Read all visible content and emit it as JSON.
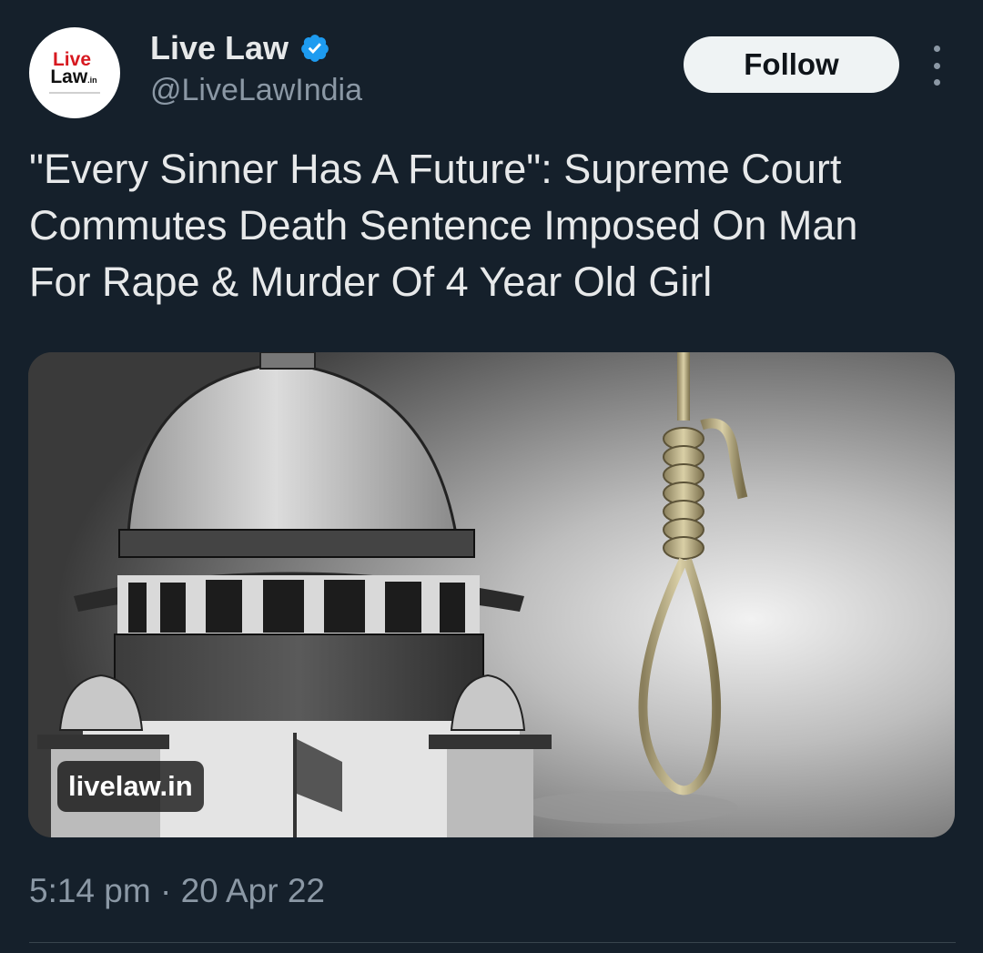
{
  "author": {
    "avatar_logo": {
      "line1": "Live",
      "line2": "Law",
      "suffix": ".in"
    },
    "display_name": "Live Law",
    "handle": "@LiveLawIndia",
    "verified_icon": "verified-badge-icon",
    "verified_color": "#1d9bf0"
  },
  "actions": {
    "follow_label": "Follow",
    "more_icon": "more-vertical-icon"
  },
  "tweet": {
    "text": "\"Every Sinner Has A Future\": Supreme Court\nCommutes Death Sentence Imposed On Man\nFor Rape & Murder Of 4 Year Old Girl"
  },
  "media": {
    "source_label": "livelaw.in"
  },
  "meta": {
    "timestamp": "5:14 pm · 20 Apr 22"
  },
  "colors": {
    "background": "#15202b",
    "text_primary": "#e7e9ea",
    "text_secondary": "#8b98a5",
    "follow_bg": "#eff3f4"
  }
}
